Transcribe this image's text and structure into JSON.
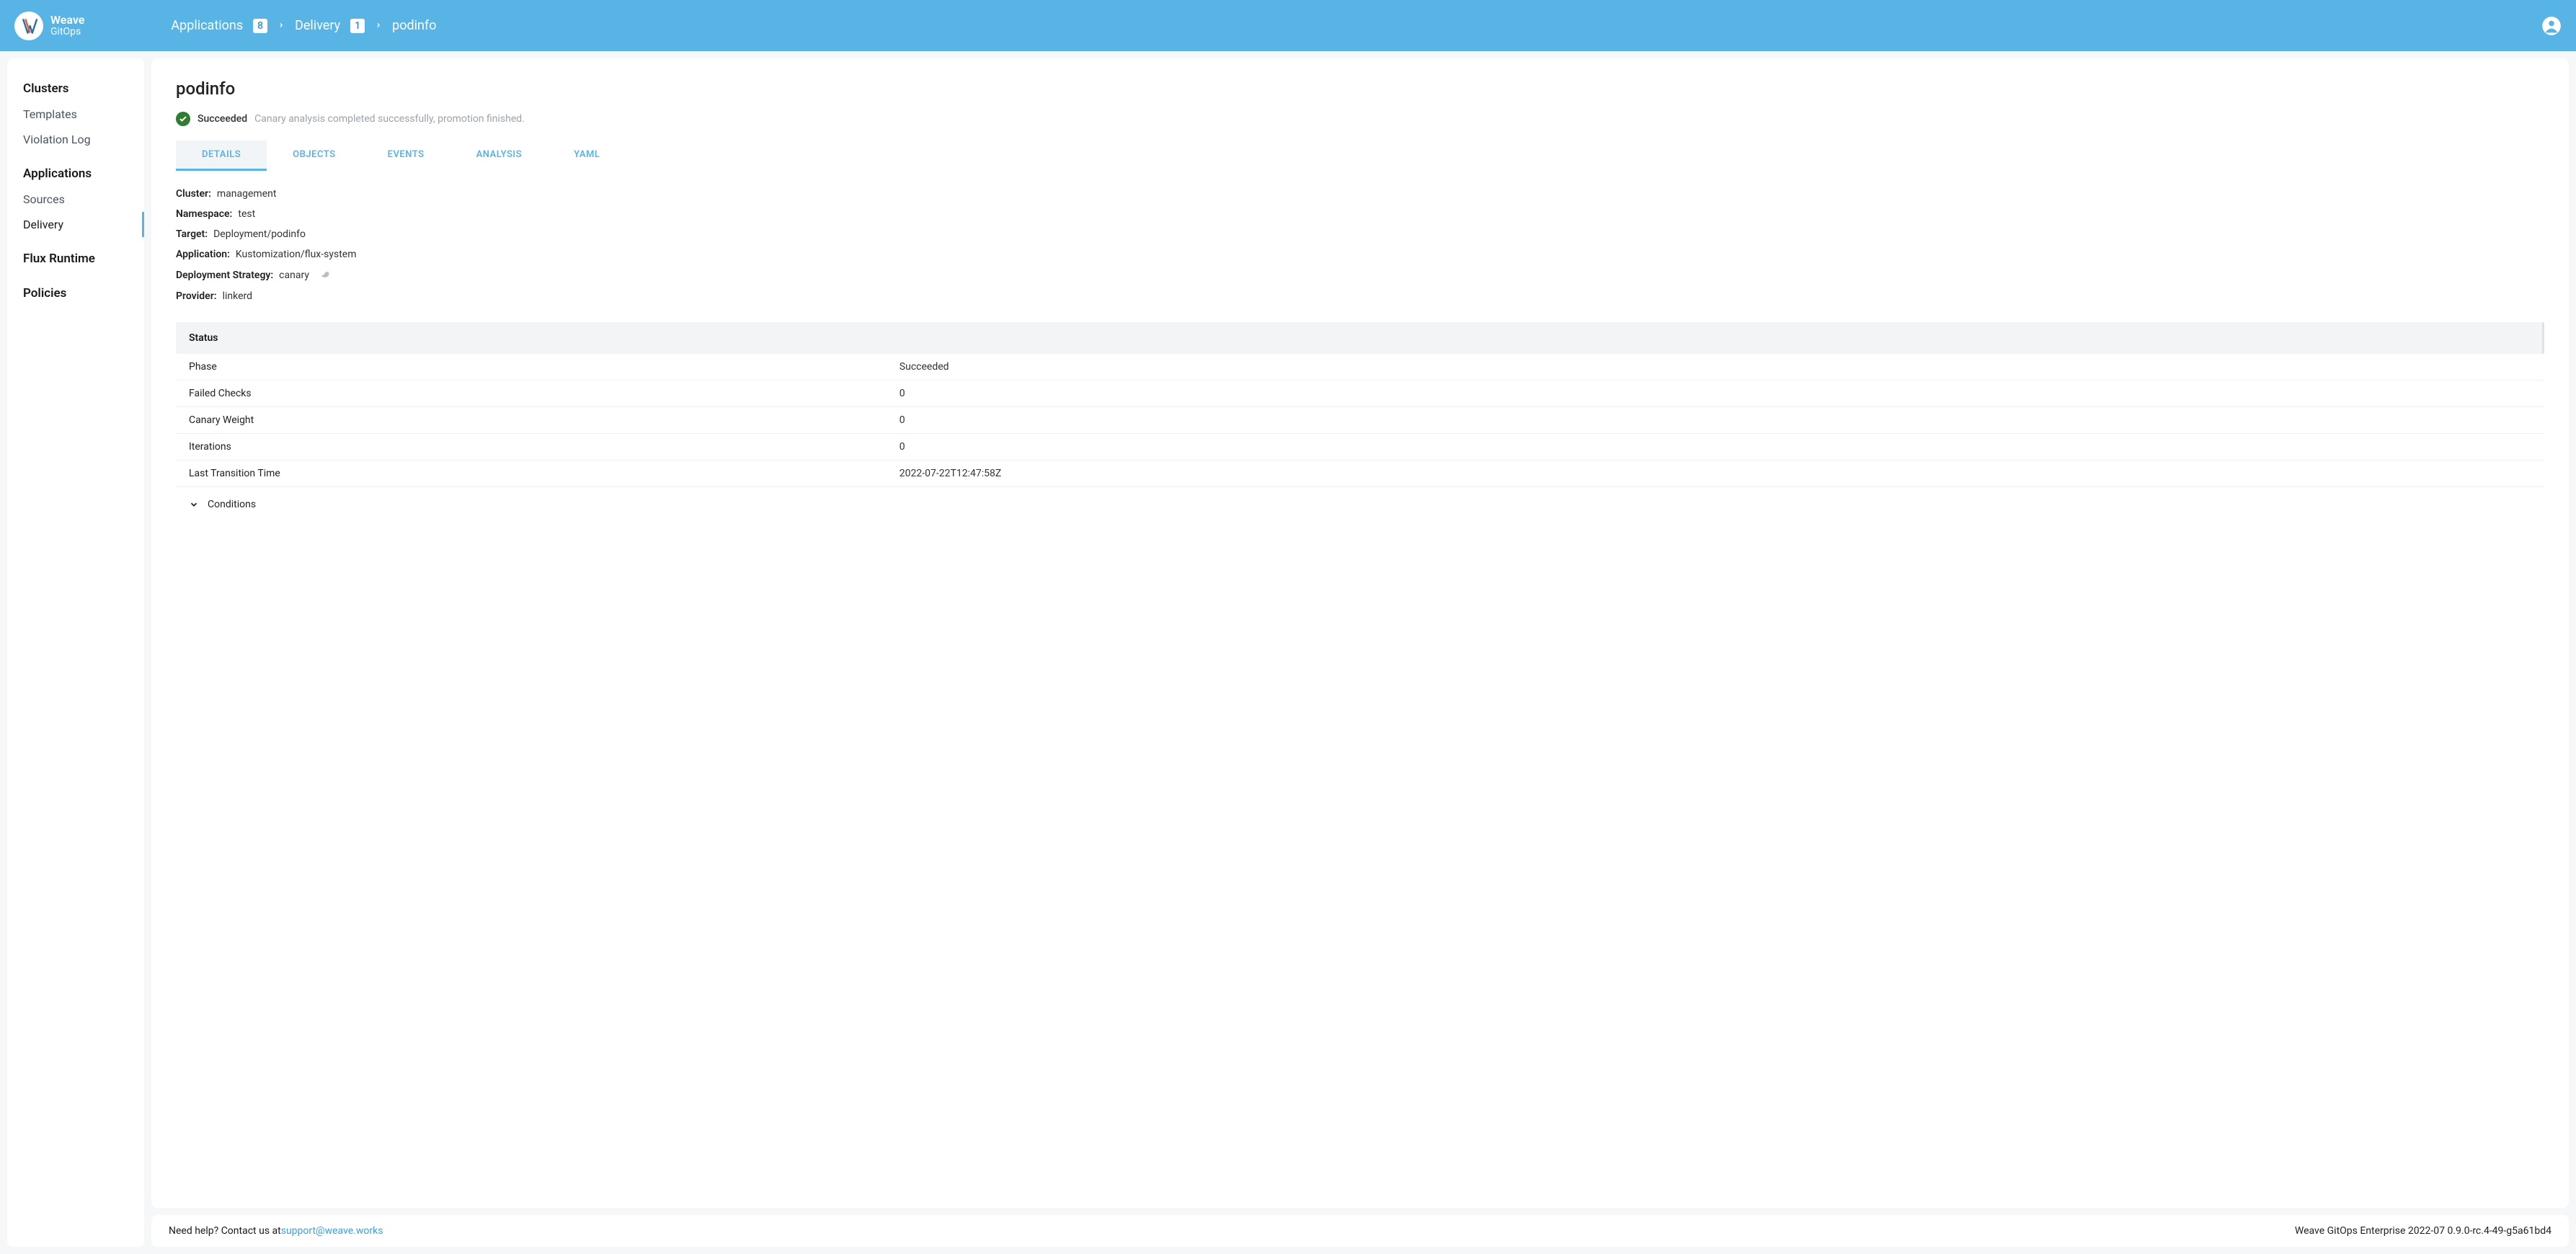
{
  "brand": {
    "line1": "Weave",
    "line2": "GitOps"
  },
  "breadcrumb": {
    "applications": {
      "label": "Applications",
      "count": "8"
    },
    "delivery": {
      "label": "Delivery",
      "count": "1"
    },
    "current": "podinfo"
  },
  "sidebar": {
    "clusters": "Clusters",
    "templates": "Templates",
    "violation_log": "Violation Log",
    "applications": "Applications",
    "sources": "Sources",
    "delivery": "Delivery",
    "flux_runtime": "Flux Runtime",
    "policies": "Policies"
  },
  "page": {
    "title": "podinfo",
    "status_label": "Succeeded",
    "status_message": "Canary analysis completed successfully, promotion finished."
  },
  "tabs": {
    "details": "DETAILS",
    "objects": "OBJECTS",
    "events": "EVENTS",
    "analysis": "ANALYSIS",
    "yaml": "YAML"
  },
  "details": {
    "labels": {
      "cluster": "Cluster:",
      "namespace": "Namespace:",
      "target": "Target:",
      "application": "Application:",
      "deployment_strategy": "Deployment Strategy:",
      "provider": "Provider:"
    },
    "values": {
      "cluster": "management",
      "namespace": "test",
      "target": "Deployment/podinfo",
      "application": "Kustomization/flux-system",
      "deployment_strategy": "canary",
      "provider": "linkerd"
    }
  },
  "status": {
    "heading": "Status",
    "rows": [
      {
        "k": "Phase",
        "v": "Succeeded"
      },
      {
        "k": "Failed Checks",
        "v": "0"
      },
      {
        "k": "Canary Weight",
        "v": "0"
      },
      {
        "k": "Iterations",
        "v": "0"
      },
      {
        "k": "Last Transition Time",
        "v": "2022-07-22T12:47:58Z"
      }
    ],
    "conditions_label": "Conditions"
  },
  "footer": {
    "help_prefix": "Need help? Contact us at ",
    "help_email": "support@weave.works",
    "version": "Weave GitOps Enterprise 2022-07 0.9.0-rc.4-49-g5a61bd4"
  }
}
